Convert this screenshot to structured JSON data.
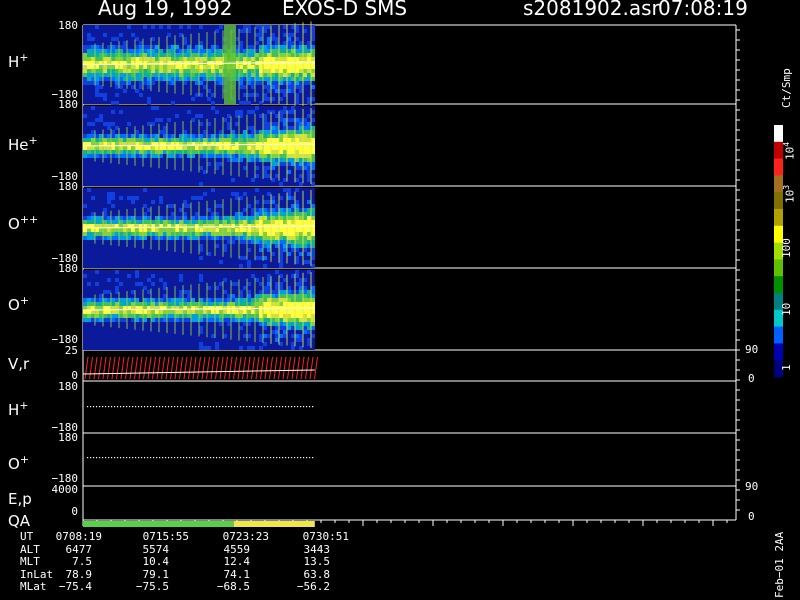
{
  "header": {
    "date": "Aug 19, 1992",
    "instrument": "EXOS-D SMS",
    "file": "s2081902.asr",
    "time": "07:08:19"
  },
  "panels": [
    {
      "id": "h",
      "base": "H",
      "sup": "+",
      "top": "180",
      "bottom": "−180"
    },
    {
      "id": "he",
      "base": "He",
      "sup": "+",
      "top": "180",
      "bottom": "−180"
    },
    {
      "id": "opp",
      "base": "O",
      "sup": "++",
      "top": "180",
      "bottom": "−180"
    },
    {
      "id": "op",
      "base": "O",
      "sup": "+",
      "top": "180",
      "bottom": "−180"
    }
  ],
  "vr": {
    "label": "V,r",
    "top": "25",
    "bottom": "0",
    "right_top": "90",
    "right_bottom": "0"
  },
  "h_line": {
    "base": "H",
    "sup": "+",
    "top": "180",
    "bottom": "−180"
  },
  "o_line": {
    "base": "O",
    "sup": "+",
    "top": "180",
    "bottom": "−180"
  },
  "ep": {
    "label": "E,p",
    "top": "4000",
    "bottom": "0",
    "right_top": "90",
    "right_bottom": "0"
  },
  "qa": {
    "label": "QA",
    "segments": [
      {
        "color": "#5ad04a",
        "frac": 0.65
      },
      {
        "color": "#f0e64a",
        "frac": 0.35
      }
    ]
  },
  "colorbar": {
    "unit": "Ct/Smp",
    "labels": [
      {
        "base": "10",
        "sup": "4"
      },
      {
        "base": "10",
        "sup": "3"
      },
      {
        "base": "100",
        "sup": ""
      },
      {
        "base": "10",
        "sup": ""
      },
      {
        "base": "1",
        "sup": ""
      }
    ],
    "colors": [
      "#ffffff",
      "#c00000",
      "#ff2020",
      "#a07020",
      "#807000",
      "#b0a000",
      "#ffff00",
      "#a0e000",
      "#60c000",
      "#009000",
      "#008080",
      "#00c8c8",
      "#0060ff",
      "#0000b0",
      "#00007a"
    ]
  },
  "table": {
    "rows": [
      {
        "label": "UT",
        "values": [
          "0708:19",
          "0715:55",
          "0723:23",
          "0730:51"
        ]
      },
      {
        "label": "ALT",
        "values": [
          "6477",
          "5574",
          "4559",
          "3443"
        ]
      },
      {
        "label": "MLT",
        "values": [
          "7.5",
          "10.4",
          "12.4",
          "13.5"
        ]
      },
      {
        "label": "InLat",
        "values": [
          "78.9",
          "79.1",
          "74.1",
          "63.8"
        ]
      },
      {
        "label": "MLat",
        "values": [
          "−75.4",
          "−75.5",
          "−68.5",
          "−56.2"
        ]
      }
    ]
  },
  "footer": "Feb−01 2AA",
  "chart_data": {
    "type": "heatmap",
    "title": "Aug 19, 1992   EXOS-D SMS",
    "x_ticks": [
      "0708:19",
      "0715:55",
      "0723:23",
      "0730:51"
    ],
    "data_end_frac": 0.355,
    "series": [
      {
        "name": "H+",
        "ylim": [
          -180,
          180
        ],
        "center": 0
      },
      {
        "name": "He+",
        "ylim": [
          -180,
          180
        ],
        "center": 0
      },
      {
        "name": "O++",
        "ylim": [
          -180,
          180
        ],
        "center": 0
      },
      {
        "name": "O+",
        "ylim": [
          -180,
          180
        ],
        "center": 0
      }
    ],
    "colorbar": {
      "scale": "log",
      "range": [
        1,
        10000
      ],
      "unit": "Ct/Smp"
    }
  }
}
